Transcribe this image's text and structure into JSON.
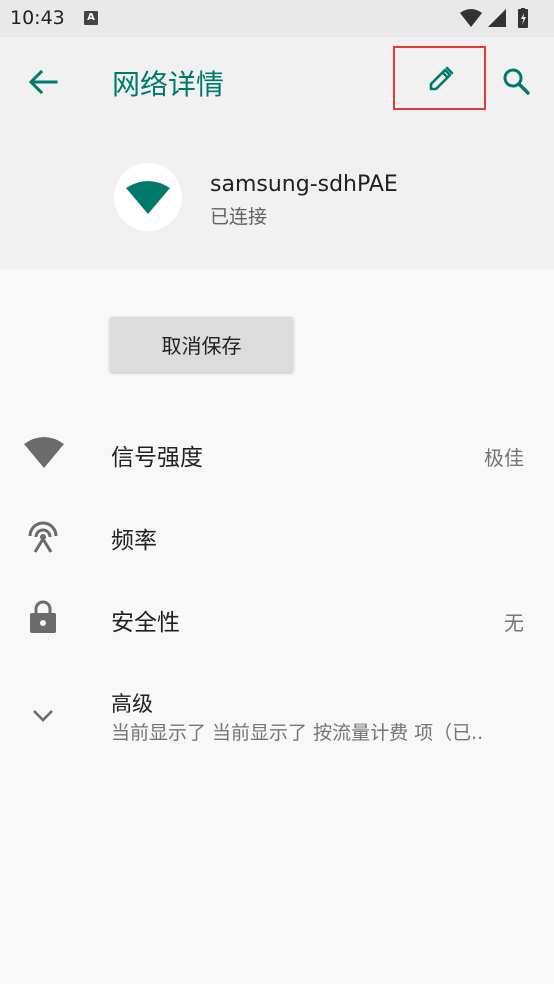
{
  "status_bar": {
    "time": "10:43",
    "notif_letter": "A"
  },
  "app_bar": {
    "title": "网络详情"
  },
  "network": {
    "name": "samsung-sdhPAE",
    "status": "已连接"
  },
  "forget_button": {
    "label": "取消保存"
  },
  "details": [
    {
      "title": "信号强度",
      "value": "极佳",
      "icon": "wifi-signal-icon"
    },
    {
      "title": "频率",
      "value": "",
      "icon": "antenna-icon"
    },
    {
      "title": "安全性",
      "value": "无",
      "icon": "lock-icon"
    }
  ],
  "advanced": {
    "title": "高级",
    "summary": "当前显示了 当前显示了 按流量计费 项（已..",
    "icon": "chevron-down-icon"
  },
  "colors": {
    "accent": "#00796b",
    "highlight_border": "#e53935"
  }
}
